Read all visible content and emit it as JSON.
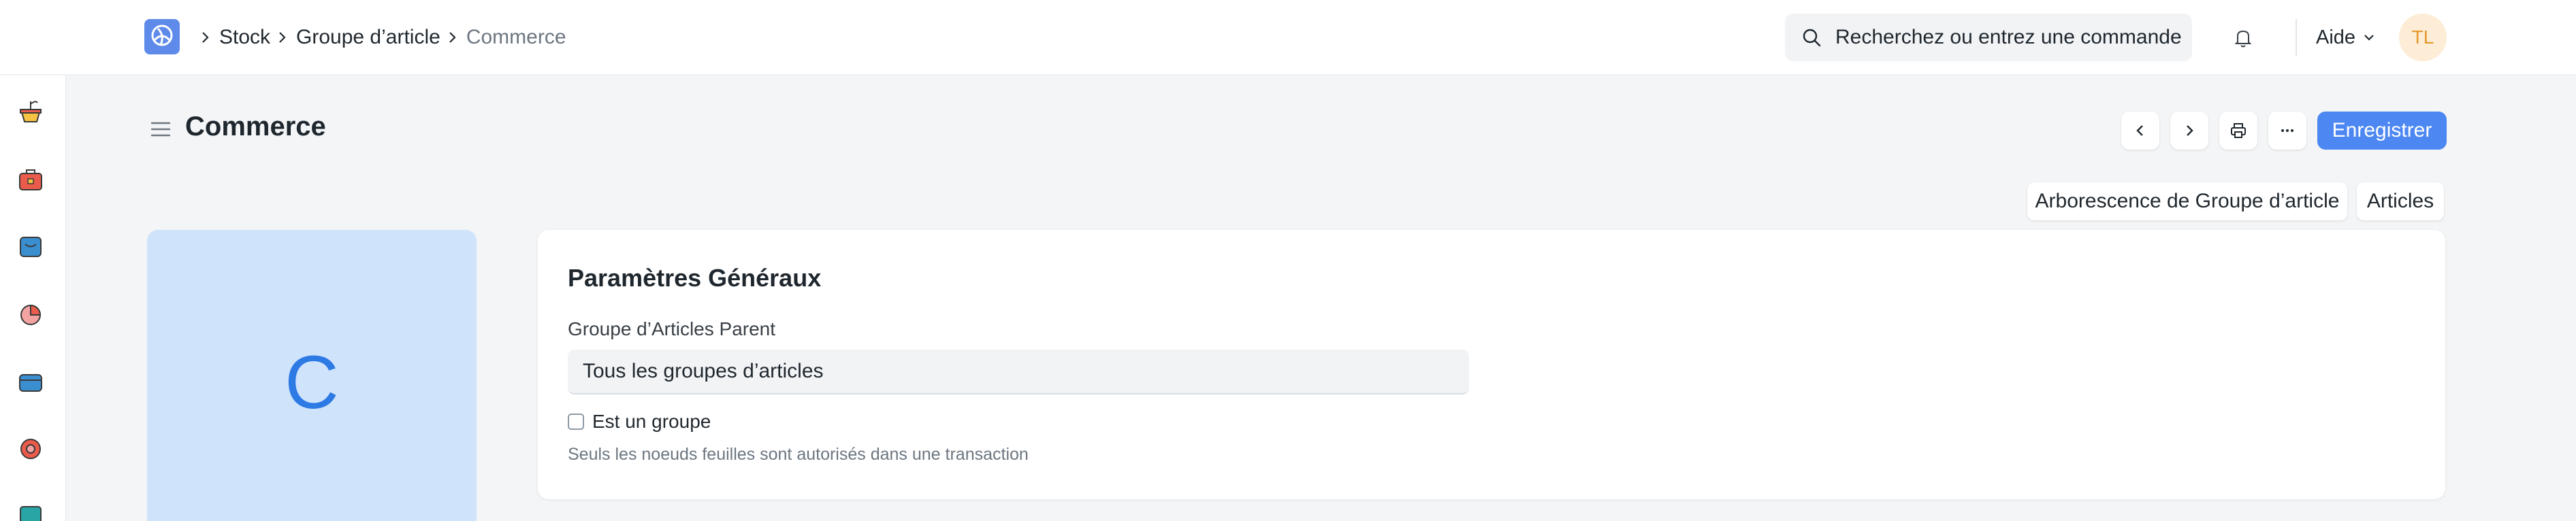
{
  "navbar": {
    "logo_icon": "app-logo-icon",
    "breadcrumbs": [
      "Stock",
      "Groupe d’article",
      "Commerce"
    ],
    "search_placeholder": "Recherchez ou entrez une commande",
    "help_label": "Aide",
    "avatar_initials": "TL"
  },
  "sidebar": {
    "icons": [
      "plant-icon",
      "toolbox-icon",
      "package-icon",
      "chart-pie-icon",
      "wallet-icon",
      "support-icon",
      "inventory-icon"
    ]
  },
  "page": {
    "title": "Commerce",
    "save_label": "Enregistrer",
    "actions": [
      "previous-icon",
      "next-icon",
      "print-icon",
      "more-icon"
    ],
    "links": [
      "Arborescence de Groupe d’article",
      "Articles"
    ]
  },
  "image_placeholder": {
    "letter": "C"
  },
  "form": {
    "section_title": "Paramètres Généraux",
    "parent_label": "Groupe d’Articles Parent",
    "parent_value": "Tous les groupes d’articles",
    "is_group_label": "Est un groupe",
    "is_group_checked": false,
    "help_text": "Seuls les noeuds feuilles sont autorisés dans une transaction"
  },
  "colors": {
    "primary": "#4c87f2",
    "avatar_bg": "#fdecd6",
    "avatar_text": "#e5992c",
    "image_bg": "#cfe3fb"
  }
}
